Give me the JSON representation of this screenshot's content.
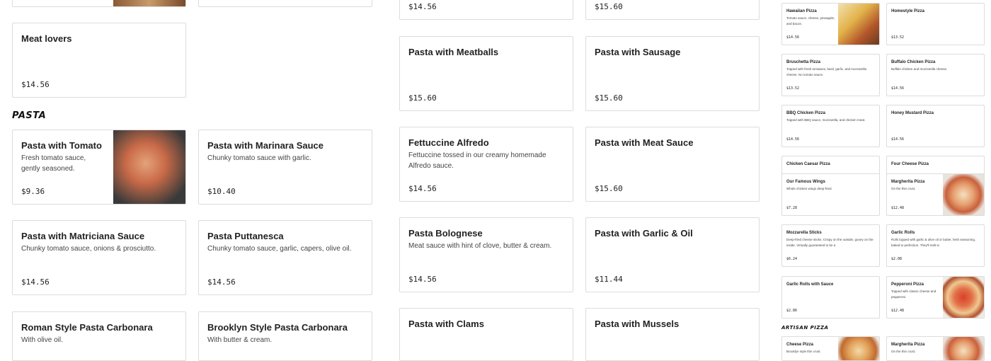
{
  "col1": {
    "top_card": {},
    "meat_lovers": {
      "title": "Meat lovers",
      "price": "$14.56"
    },
    "section_title": "pasta",
    "pasta_tomato": {
      "title": "Pasta with Tomato",
      "desc": "Fresh tomato sauce, gently seasoned.",
      "price": "$9.36"
    },
    "pasta_marinara": {
      "title": "Pasta with Marinara Sauce",
      "desc": "Chunky tomato sauce with garlic.",
      "price": "$10.40"
    },
    "pasta_matriciana": {
      "title": "Pasta with Matriciana Sauce",
      "desc": "Chunky tomato sauce, onions & prosciutto.",
      "price": "$14.56"
    },
    "pasta_puttanesca": {
      "title": "Pasta Puttanesca",
      "desc": "Chunky tomato sauce, garlic, capers, olive oil.",
      "price": "$14.56"
    },
    "roman_carbonara": {
      "title": "Roman Style Pasta Carbonara",
      "desc": "With olive oil."
    },
    "brooklyn_carbonara": {
      "title": "Brooklyn Style Pasta Carbonara",
      "desc": "With butter & cream."
    }
  },
  "col2": {
    "top_left_price": "$14.56",
    "top_right_price": "$15.60",
    "meatballs": {
      "title": "Pasta with Meatballs",
      "price": "$15.60"
    },
    "sausage": {
      "title": "Pasta with Sausage",
      "price": "$15.60"
    },
    "alfredo": {
      "title": "Fettuccine Alfredo",
      "desc": "Fettuccine tossed in our creamy homemade Alfredo sauce.",
      "price": "$14.56"
    },
    "meat_sauce": {
      "title": "Pasta with Meat Sauce",
      "price": "$15.60"
    },
    "bolognese": {
      "title": "Pasta Bolognese",
      "desc": "Meat sauce with hint of clove, butter & cream.",
      "price": "$14.56"
    },
    "garlic_oil": {
      "title": "Pasta with Garlic & Oil",
      "price": "$11.44"
    },
    "clams": {
      "title": "Pasta with Clams"
    },
    "mussels": {
      "title": "Pasta with Mussels"
    }
  },
  "col3": {
    "hawaiian": {
      "title": "Hawaiian Pizza",
      "desc": "Tomato sauce, cheese, pineapple, and bacon.",
      "price": "$14.56"
    },
    "homestyle": {
      "title": "Homestyle Pizza",
      "price": "$13.52"
    },
    "bruschetta": {
      "title": "Bruschetta Pizza",
      "desc": "Topped with fresh tomatoes, basil, garlic, and mozzarella cheese. No tomato sauce.",
      "price": "$13.52"
    },
    "buffalo": {
      "title": "Buffalo Chicken Pizza",
      "desc": "Buffalo chicken and mozzarella cheese.",
      "price": "$14.56"
    },
    "bbq": {
      "title": "BBQ Chicken Pizza",
      "desc": "Topped with BBQ sauce, mozzarella, and chicken meat.",
      "price": "$14.56"
    },
    "honey": {
      "title": "Honey Mustard Pizza",
      "price": "$14.56"
    },
    "caesar": {
      "title": "Chicken Caesar Pizza"
    },
    "four_cheese": {
      "title": "Four Cheese Pizza"
    },
    "wings": {
      "title": "Our Famous Wings",
      "desc": "Whole chicken wings deep-fried.",
      "price": "$7.28"
    },
    "margherita": {
      "title": "Margherita Pizza",
      "desc": "On the thin crust.",
      "price": "$12.48"
    },
    "mozz_sticks": {
      "title": "Mozzarella Sticks",
      "desc": "Deep-fried cheese sticks. Crispy on the outside, gooey on the inside. Virtually guaranteed to be a",
      "price": "$6.24"
    },
    "garlic_rolls": {
      "title": "Garlic Rolls",
      "desc": "Rolls topped with garlic & olive oil or butter, herb seasoning, baked to perfection. They'll melt in",
      "price": "$2.08"
    },
    "garlic_rolls_sauce": {
      "title": "Garlic Rolls with Sauce",
      "price": "$2.86"
    },
    "pepperoni": {
      "title": "Pepperoni Pizza",
      "desc": "Topped with classic cheese and pepperoni.",
      "price": "$12.48"
    },
    "section_title": "artisan pizza",
    "cheese_artisan": {
      "title": "Cheese Pizza",
      "desc": "Brooklyn style thin crust."
    },
    "margherita_artisan": {
      "title": "Margherita Pizza",
      "desc": "On the thin crust."
    }
  }
}
